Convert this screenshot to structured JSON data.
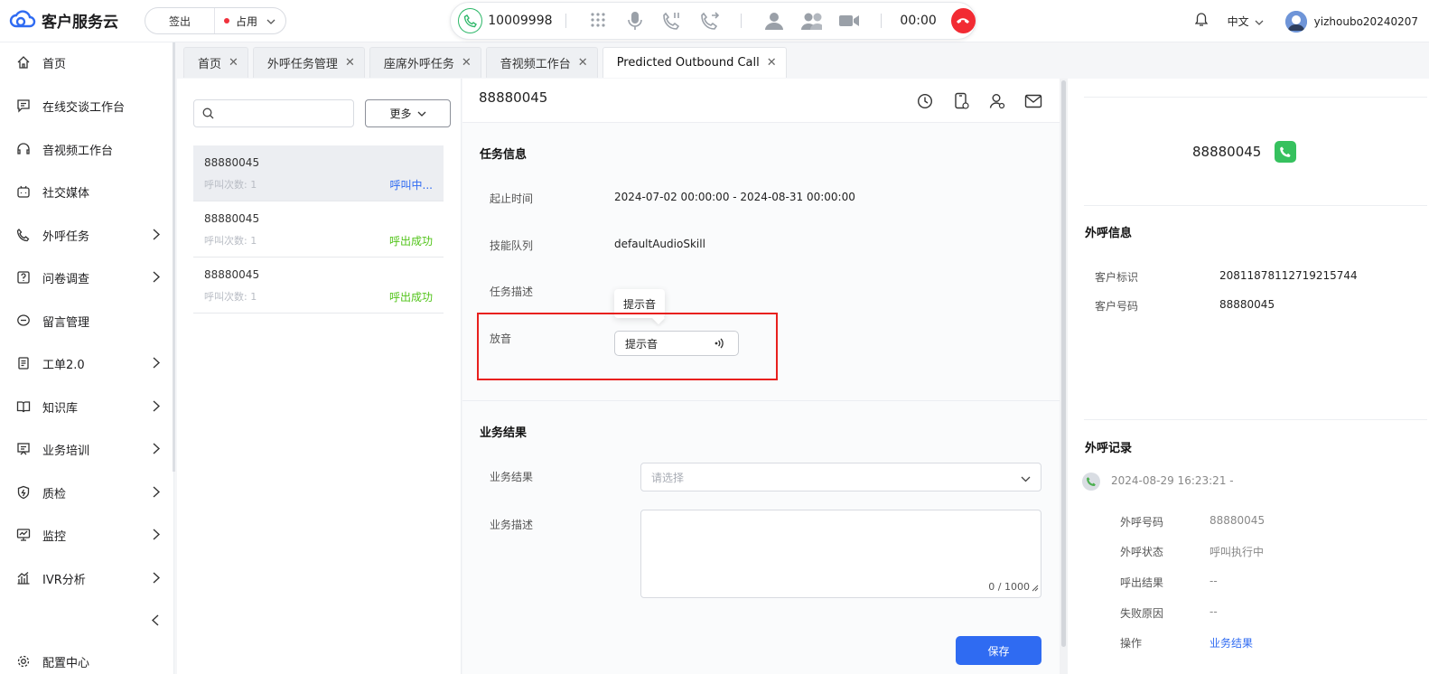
{
  "app": {
    "title": "客户服务云"
  },
  "agent_state": {
    "signout_label": "签出",
    "status_label": "占用"
  },
  "callbar": {
    "number": "10009998",
    "timer": "00:00"
  },
  "header": {
    "language": "中文",
    "username": "yizhoubo20240207"
  },
  "sidebar": {
    "items": [
      {
        "label": "首页",
        "icon": "home-icon",
        "arrow": false
      },
      {
        "label": "在线交谈工作台",
        "icon": "chat-icon",
        "arrow": false
      },
      {
        "label": "音视频工作台",
        "icon": "headset-icon",
        "arrow": false
      },
      {
        "label": "社交媒体",
        "icon": "robot-icon",
        "arrow": false
      },
      {
        "label": "外呼任务",
        "icon": "outbound-phone-icon",
        "arrow": true
      },
      {
        "label": "问卷调查",
        "icon": "survey-icon",
        "arrow": true
      },
      {
        "label": "留言管理",
        "icon": "message-icon",
        "arrow": false
      },
      {
        "label": "工单2.0",
        "icon": "ticket-icon",
        "arrow": true
      },
      {
        "label": "知识库",
        "icon": "book-icon",
        "arrow": true
      },
      {
        "label": "业务培训",
        "icon": "training-icon",
        "arrow": true
      },
      {
        "label": "质检",
        "icon": "shield-icon",
        "arrow": true
      },
      {
        "label": "监控",
        "icon": "monitor-icon",
        "arrow": true
      },
      {
        "label": "IVR分析",
        "icon": "ivr-chart-icon",
        "arrow": true
      }
    ],
    "config_label": "配置中心"
  },
  "tabs": [
    {
      "label": "首页",
      "active": false
    },
    {
      "label": "外呼任务管理",
      "active": false
    },
    {
      "label": "座席外呼任务",
      "active": false
    },
    {
      "label": "音视频工作台",
      "active": false
    },
    {
      "label": "Predicted Outbound Call",
      "active": true
    }
  ],
  "list": {
    "more_label": "更多",
    "items": [
      {
        "number": "88880045",
        "count_label": "呼叫次数: 1",
        "status": "呼叫中...",
        "status_color": "#2f6bf2",
        "selected": true
      },
      {
        "number": "88880045",
        "count_label": "呼叫次数: 1",
        "status": "呼出成功",
        "status_color": "#52c41a",
        "selected": false
      },
      {
        "number": "88880045",
        "count_label": "呼叫次数: 1",
        "status": "呼出成功",
        "status_color": "#52c41a",
        "selected": false
      }
    ]
  },
  "detail": {
    "number": "88880045",
    "task_section_title": "任务信息",
    "fields": [
      {
        "label": "起止时间",
        "value": "2024-07-02 00:00:00 - 2024-08-31 00:00:00"
      },
      {
        "label": "技能队列",
        "value": "defaultAudioSkill"
      },
      {
        "label": "任务描述",
        "value": ""
      }
    ],
    "play_label": "放音",
    "tooltip_text": "提示音",
    "play_button_label": "提示音",
    "result_section_title": "业务结果",
    "result_label": "业务结果",
    "result_placeholder": "请选择",
    "desc_label": "业务描述",
    "desc_counter": "0 / 1000",
    "save_label": "保存"
  },
  "right": {
    "number": "88880045",
    "outbound_info_title": "外呼信息",
    "info": [
      {
        "label": "客户标识",
        "value": "20811878112719215744"
      },
      {
        "label": "客户号码",
        "value": "88880045"
      }
    ],
    "record_title": "外呼记录",
    "record_time": "2024-08-29 16:23:21 -",
    "record_fields": [
      {
        "label": "外呼号码",
        "value": "88880045"
      },
      {
        "label": "外呼状态",
        "value": "呼叫执行中"
      },
      {
        "label": "呼出结果",
        "value": "--"
      },
      {
        "label": "失败原因",
        "value": "--"
      },
      {
        "label": "操作",
        "value": "业务结果"
      }
    ]
  }
}
